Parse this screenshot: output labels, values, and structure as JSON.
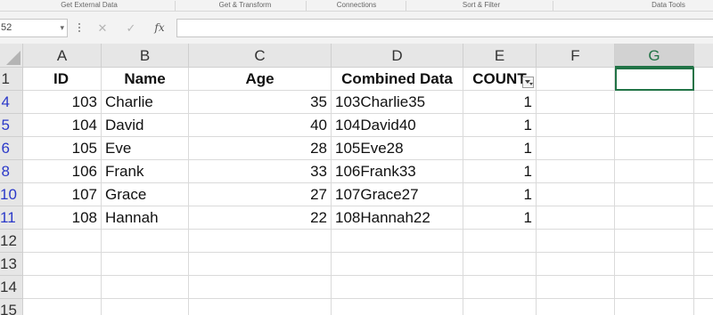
{
  "ribbon": {
    "groups": [
      "Get External Data",
      "Get & Transform",
      "Connections",
      "Sort & Filter",
      "Data Tools"
    ]
  },
  "formula_bar": {
    "name_box": "52",
    "cancel_icon": "✕",
    "enter_icon": "✓",
    "fx_label": "fx",
    "formula": ""
  },
  "sheet": {
    "columns": [
      "A",
      "B",
      "C",
      "D",
      "E",
      "F",
      "G"
    ],
    "selected_column": "G",
    "header_row_number": "1",
    "headers": [
      "ID",
      "Name",
      "Age",
      "Combined Data",
      "COUNT"
    ],
    "rows": [
      {
        "row": "4",
        "id": "103",
        "name": "Charlie",
        "age": "35",
        "combined": "103Charlie35",
        "count": "1"
      },
      {
        "row": "5",
        "id": "104",
        "name": "David",
        "age": "40",
        "combined": "104David40",
        "count": "1"
      },
      {
        "row": "6",
        "id": "105",
        "name": "Eve",
        "age": "28",
        "combined": "105Eve28",
        "count": "1"
      },
      {
        "row": "8",
        "id": "106",
        "name": "Frank",
        "age": "33",
        "combined": "106Frank33",
        "count": "1"
      },
      {
        "row": "10",
        "id": "107",
        "name": "Grace",
        "age": "27",
        "combined": "107Grace27",
        "count": "1"
      },
      {
        "row": "11",
        "id": "108",
        "name": "Hannah",
        "age": "22",
        "combined": "108Hannah22",
        "count": "1"
      }
    ],
    "empty_rows": [
      "12",
      "13",
      "14",
      "15"
    ]
  },
  "colors": {
    "filtered_row_number": "#2b39c9",
    "selection_accent": "#217346"
  }
}
